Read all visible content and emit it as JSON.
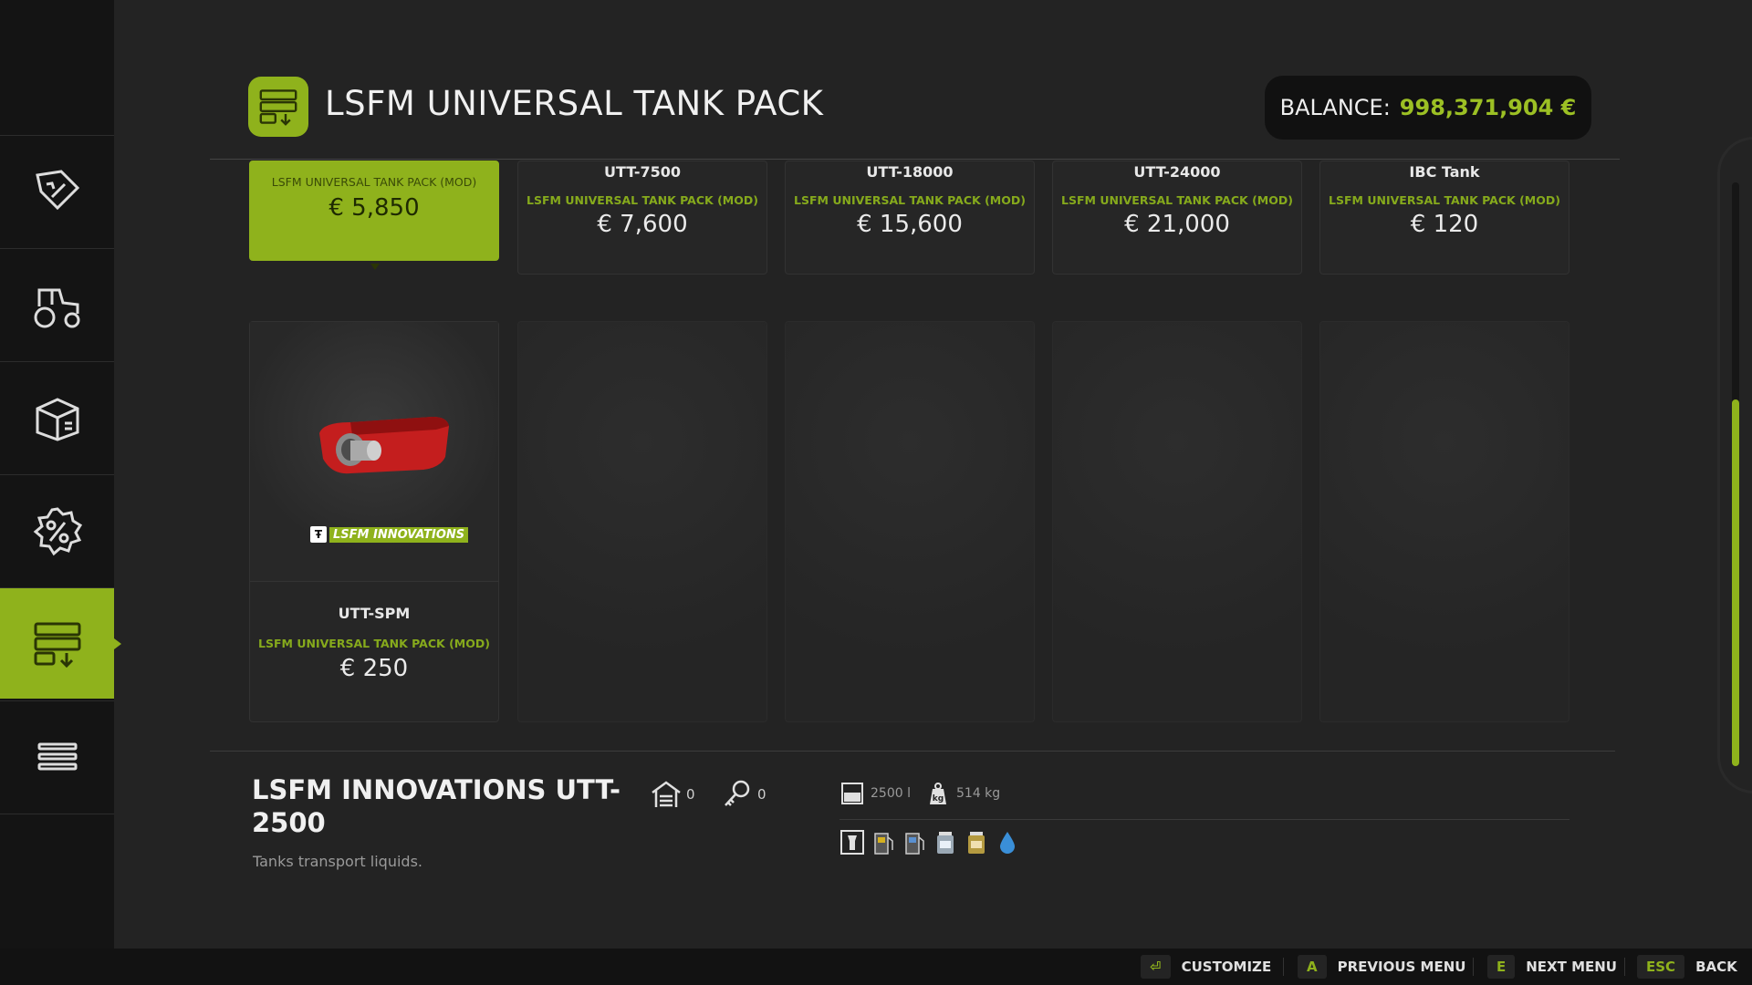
{
  "header": {
    "title": "LSFM UNIVERSAL TANK PACK",
    "balance_label": "BALANCE:",
    "balance_value": "998,371,904 €"
  },
  "sidebar": {
    "items": [
      {
        "icon": "price-tag-icon"
      },
      {
        "icon": "tractor-icon"
      },
      {
        "icon": "box-icon"
      },
      {
        "icon": "discount-icon"
      },
      {
        "icon": "tank-pack-icon",
        "active": true
      },
      {
        "icon": "list-icon"
      }
    ]
  },
  "products": [
    {
      "name": "",
      "pack": "LSFM UNIVERSAL TANK PACK (MOD)",
      "price": "€ 5,850",
      "selected": true
    },
    {
      "name": "UTT-7500",
      "pack": "LSFM UNIVERSAL TANK PACK (MOD)",
      "price": "€ 7,600"
    },
    {
      "name": "UTT-18000",
      "pack": "LSFM UNIVERSAL TANK PACK (MOD)",
      "price": "€ 15,600"
    },
    {
      "name": "UTT-24000",
      "pack": "LSFM UNIVERSAL TANK PACK (MOD)",
      "price": "€ 21,000"
    },
    {
      "name": "IBC Tank",
      "pack": "LSFM UNIVERSAL TANK PACK (MOD)",
      "price": "€ 120"
    },
    {
      "name": "UTT-SPM",
      "pack": "LSFM UNIVERSAL TANK PACK (MOD)",
      "price": "€ 250",
      "brand": "LSFM INNOVATIONS"
    }
  ],
  "detail": {
    "title": "LSFM INNOVATIONS UTT-2500",
    "description": "Tanks transport liquids.",
    "owned_count": "0",
    "leased_count": "0",
    "capacity": "2500 l",
    "weight": "514 kg",
    "fill_types": [
      "milk-icon",
      "fuel-icon",
      "diesel-icon",
      "liquid-fertilizer-icon",
      "herbicide-icon",
      "water-icon"
    ]
  },
  "footer": {
    "customize_label": "CUSTOMIZE",
    "prev_key": "A",
    "prev_label": "PREVIOUS MENU",
    "next_key": "E",
    "next_label": "NEXT MENU",
    "back_key": "ESC",
    "back_label": "BACK"
  },
  "colors": {
    "accent": "#8fb21c",
    "balance": "#9cc024"
  }
}
